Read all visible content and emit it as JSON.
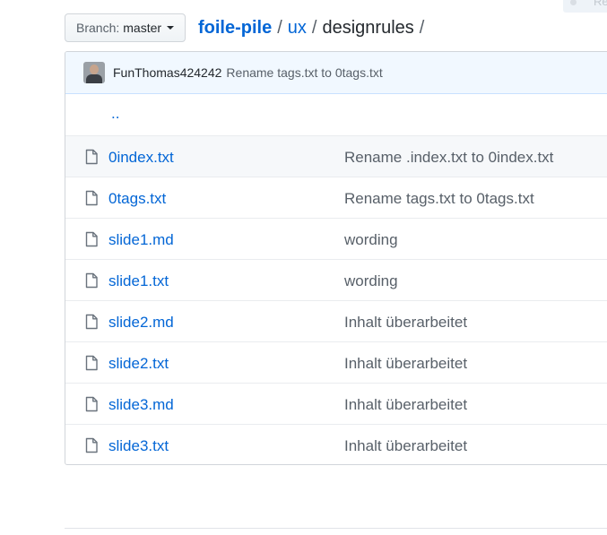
{
  "top_chip": {
    "text": "Re"
  },
  "branch": {
    "label": "Branch:",
    "value": "master"
  },
  "breadcrumb": {
    "repo": "foile-pile",
    "sep1": "/",
    "dir": "ux",
    "sep2": "/",
    "current": "designrules",
    "sep3": "/"
  },
  "commit": {
    "author": "FunThomas424242",
    "message": "Rename tags.txt to 0tags.txt"
  },
  "parent_link": "..",
  "files": [
    {
      "name": "0index.txt",
      "message": "Rename .index.txt to 0index.txt"
    },
    {
      "name": "0tags.txt",
      "message": "Rename tags.txt to 0tags.txt"
    },
    {
      "name": "slide1.md",
      "message": "wording"
    },
    {
      "name": "slide1.txt",
      "message": "wording"
    },
    {
      "name": "slide2.md",
      "message": "Inhalt überarbeitet"
    },
    {
      "name": "slide2.txt",
      "message": "Inhalt überarbeitet"
    },
    {
      "name": "slide3.md",
      "message": "Inhalt überarbeitet"
    },
    {
      "name": "slide3.txt",
      "message": "Inhalt überarbeitet"
    }
  ],
  "colors": {
    "link": "#0366d6",
    "muted": "#586069",
    "commit_bar_bg": "#f1f8ff",
    "border": "#d1d5da",
    "icon": "#6a737d"
  },
  "icons": {
    "file": "file-icon",
    "caret": "caret-down-icon"
  }
}
